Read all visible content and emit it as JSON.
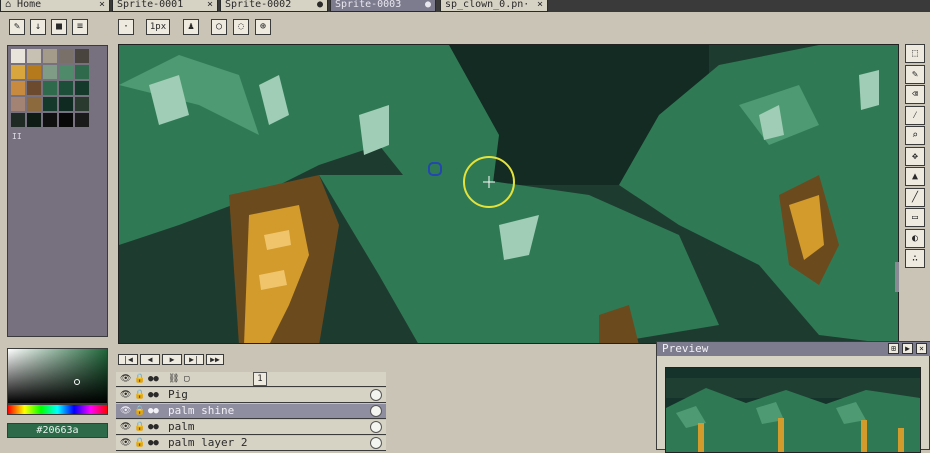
{
  "tabs": [
    {
      "label": "Home",
      "icon": "home-icon",
      "close": "×"
    },
    {
      "label": "Sprite-0001",
      "close": "×"
    },
    {
      "label": "Sprite-0002",
      "close": "●"
    },
    {
      "label": "Sprite-0003",
      "close": "●"
    },
    {
      "label": "sp_clown_0.pn·",
      "close": "×"
    }
  ],
  "toolbar": {
    "left_buttons": [
      "pencil-icon",
      "download-icon",
      "save-icon",
      "menu-icon"
    ],
    "brush_size": "1px",
    "modes": [
      "brush-mode-icon",
      "ink-icon",
      "pixel-perfect-icon",
      "contour-icon",
      "transform-icon"
    ]
  },
  "palette": {
    "colors": [
      "#e8e4dc",
      "#c7c1b3",
      "#a59b8a",
      "#7a706a",
      "#4a443f",
      "#d9a63e",
      "#b57a1c",
      "#7f9c86",
      "#4f8a6a",
      "#2f6a4d",
      "#c78a3e",
      "#6b4a2e",
      "#2f6a4d",
      "#1d4e3a",
      "#153a2c",
      "#a28374",
      "#8c6a3e",
      "#153a2c",
      "#0f2a20",
      "#2a3a2e",
      "#1f2a24",
      "#0e1a14",
      "#101010",
      "#080808",
      "#1a1a1a"
    ],
    "page_indicator": "II"
  },
  "tools": [
    "rect-marquee-icon",
    "pencil-icon",
    "eraser-icon",
    "eyedropper-icon",
    "zoom-icon",
    "move-icon",
    "paint-bucket-icon",
    "line-icon",
    "rectangle-icon",
    "ellipse-icon",
    "spray-icon"
  ],
  "color": {
    "hex": "#20663a",
    "primary": "#20663a"
  },
  "timeline": {
    "frame_number": "1",
    "controls": [
      "first-frame-icon",
      "prev-frame-icon",
      "play-icon",
      "next-frame-icon",
      "last-frame-icon"
    ],
    "layers": [
      {
        "name": "Pig",
        "selected": false
      },
      {
        "name": "palm shine",
        "selected": true
      },
      {
        "name": "palm",
        "selected": false
      },
      {
        "name": "palm layer 2",
        "selected": false
      }
    ]
  },
  "preview": {
    "title": "Preview"
  }
}
